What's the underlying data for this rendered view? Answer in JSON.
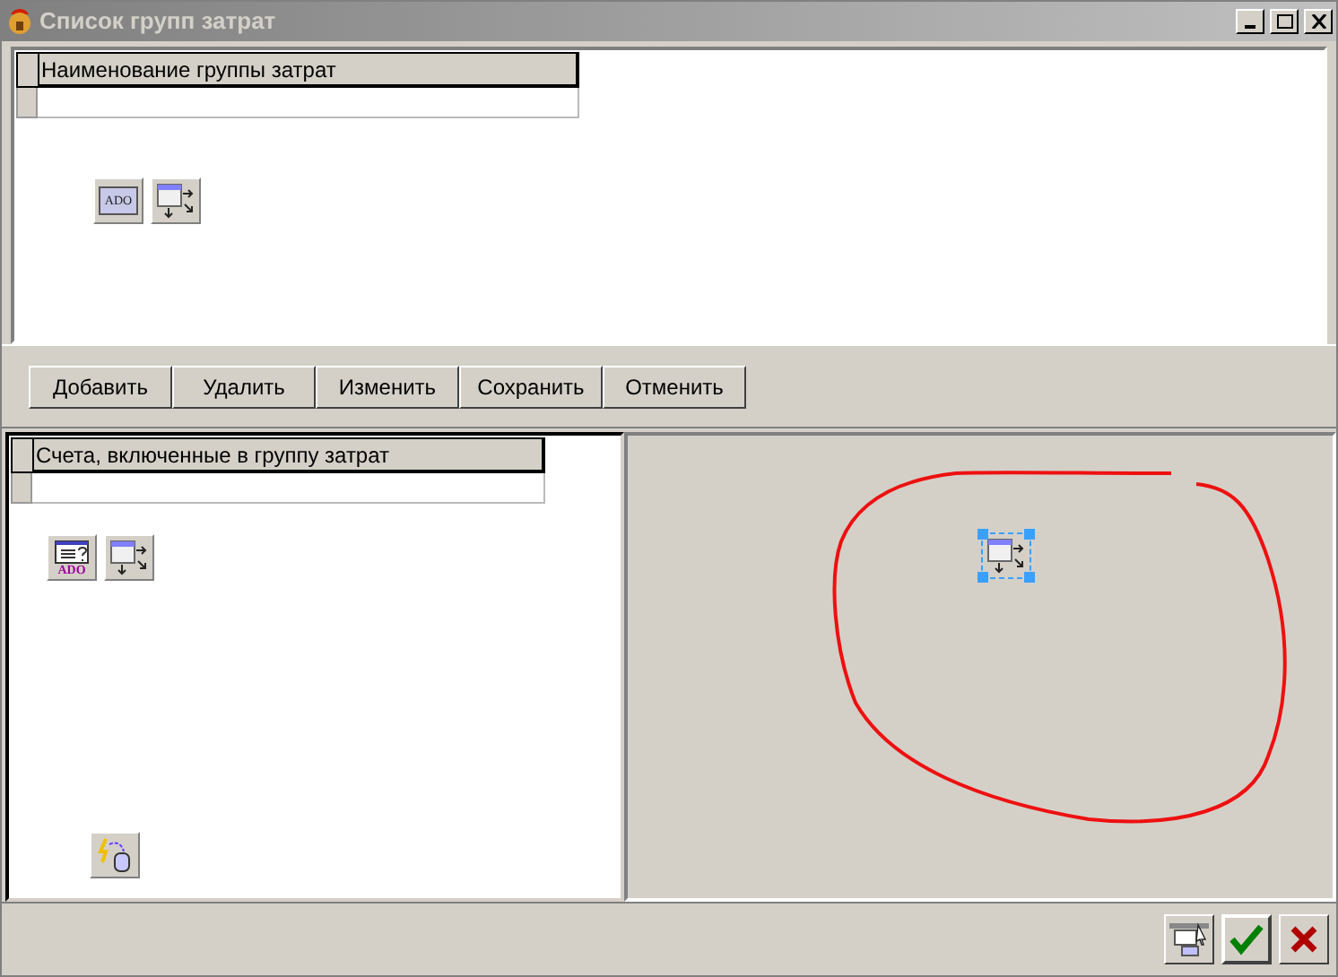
{
  "window": {
    "title": "Список групп затрат"
  },
  "top_grid": {
    "columns": [
      "Наименование группы затрат"
    ],
    "components": [
      {
        "kind": "ado_table",
        "label": "ADO"
      },
      {
        "kind": "datasource"
      }
    ]
  },
  "buttons": [
    "Добавить",
    "Удалить",
    "Изменить",
    "Сохранить",
    "Отменить"
  ],
  "bottom_grid": {
    "columns": [
      "Счета, включенные в группу затрат"
    ],
    "components": [
      {
        "kind": "ado_query",
        "label": "ADO"
      },
      {
        "kind": "datasource"
      }
    ],
    "extra": [
      {
        "kind": "connection"
      }
    ]
  },
  "designer": {
    "components": [
      {
        "kind": "datasource",
        "selected": true
      }
    ]
  },
  "footer": [
    {
      "kind": "form"
    },
    {
      "kind": "ok"
    },
    {
      "kind": "cancel"
    }
  ]
}
